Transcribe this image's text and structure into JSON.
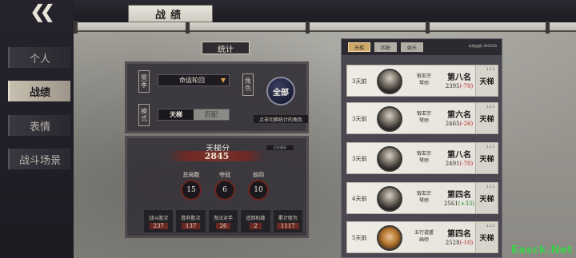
{
  "header": {
    "title": "战绩"
  },
  "sidebar": {
    "items": [
      {
        "label": "个人"
      },
      {
        "label": "战绩"
      },
      {
        "label": "表情"
      },
      {
        "label": "战斗场景"
      }
    ]
  },
  "stats_tab": "统计",
  "filter": {
    "season_label": "赛季",
    "mode_label": "模式",
    "role_label": "角色",
    "season_value": "命运轮回",
    "mode_options": [
      "天梯",
      "匹配"
    ],
    "all_button": "全部",
    "switch_hint": "点击切换统计的角色"
  },
  "stats": {
    "rating_label": "天梯分",
    "rating_value": "2845",
    "rating_tag": "历史最高",
    "circles": [
      {
        "label": "总局数",
        "value": "15"
      },
      {
        "label": "夺冠",
        "value": "6"
      },
      {
        "label": "前四",
        "value": "10"
      }
    ],
    "row": [
      {
        "label": "战斗胜次",
        "value": "237"
      },
      {
        "label": "胜利胜次",
        "value": "137"
      },
      {
        "label": "淘汰对手",
        "value": "26"
      },
      {
        "label": "追回机缘",
        "value": "2"
      },
      {
        "label": "累计修为",
        "value": "1117"
      }
    ]
  },
  "list": {
    "tabs": [
      "天梯",
      "匹配",
      "娱乐"
    ],
    "season_info": "本地战绩: 200/200",
    "matches": [
      {
        "date": "3天前",
        "role_line1": "锻玄宗",
        "role_line2": "琴师",
        "rank": "第八名",
        "score": "2395",
        "delta": "(-70)",
        "delta_sign": "neg",
        "mode": "天梯",
        "ver": "1.2.3"
      },
      {
        "date": "3天前",
        "role_line1": "锻玄宗",
        "role_line2": "琴师",
        "rank": "第六名",
        "score": "2465",
        "delta": "(-26)",
        "delta_sign": "neg",
        "mode": "天梯",
        "ver": "1.2.3"
      },
      {
        "date": "3天前",
        "role_line1": "锻玄宗",
        "role_line2": "琴师",
        "rank": "第八名",
        "score": "2491",
        "delta": "(-70)",
        "delta_sign": "neg",
        "mode": "天梯",
        "ver": "1.2.3"
      },
      {
        "date": "4天前",
        "role_line1": "锻玄宗",
        "role_line2": "琴师",
        "rank": "第四名",
        "score": "2561",
        "delta": "(+33)",
        "delta_sign": "pos",
        "mode": "天梯",
        "ver": "1.2.3"
      },
      {
        "date": "5天前",
        "role_line1": "五行道盟",
        "role_line2": "画师",
        "rank": "第四名",
        "score": "2528",
        "delta": "(-10)",
        "delta_sign": "neg",
        "mode": "天梯",
        "ver": "1.2.3"
      }
    ]
  },
  "watermark": "Easck.Net"
}
